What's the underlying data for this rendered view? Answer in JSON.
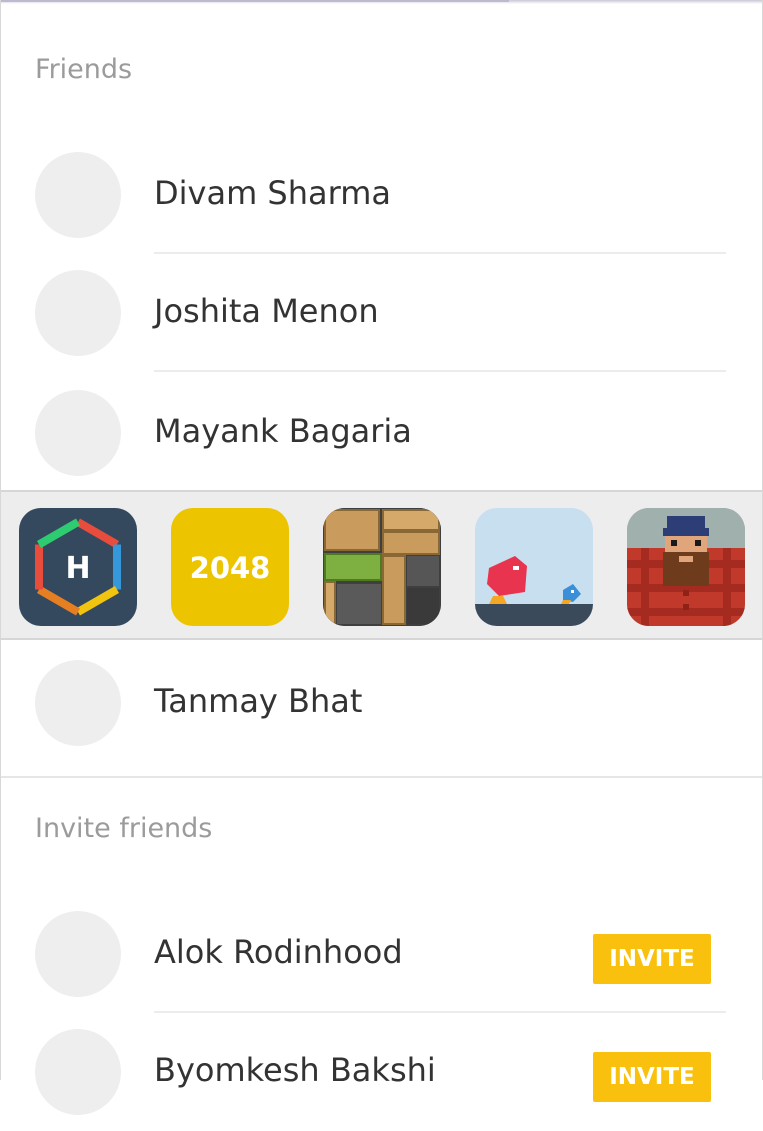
{
  "sections": {
    "friends_header": "Friends",
    "invite_header": "Invite friends"
  },
  "friends": [
    {
      "name": "Divam Sharma"
    },
    {
      "name": "Joshita Menon"
    },
    {
      "name": "Mayank Bagaria"
    },
    {
      "name": "Tanmay Bhat"
    }
  ],
  "games": [
    {
      "icon": "hexagon-h-game-icon",
      "label": "H",
      "color": "#34495e"
    },
    {
      "icon": "2048-game-icon",
      "label": "2048",
      "color": "#ecc400"
    },
    {
      "icon": "wood-block-puzzle-game-icon",
      "color": "#c79a5a"
    },
    {
      "icon": "red-bird-game-icon",
      "color": "#c8dff0"
    },
    {
      "icon": "lumberjack-game-icon",
      "color": "#c0392b"
    }
  ],
  "invite_list": [
    {
      "name": "Alok Rodinhood",
      "button": "INVITE"
    },
    {
      "name": "Byomkesh Bakshi",
      "button": "INVITE"
    }
  ],
  "colors": {
    "invite_button": "#f9c10e",
    "avatar_placeholder": "#eeeeee",
    "header_text": "#9b9b9b"
  }
}
